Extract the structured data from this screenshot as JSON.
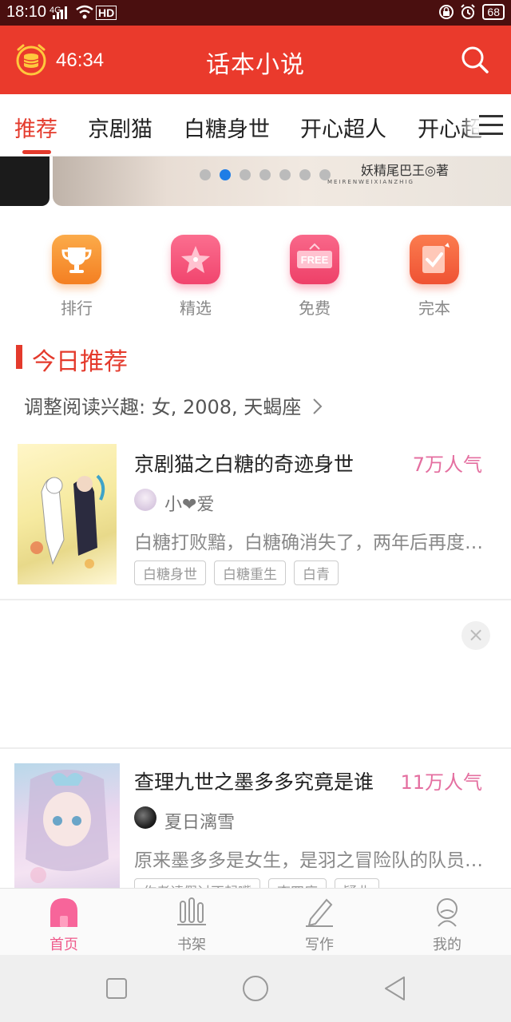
{
  "status_bar": {
    "time": "18:10",
    "signal": "4G",
    "network": "HD",
    "battery": "68"
  },
  "header": {
    "timer": "46:34",
    "title": "话本小说"
  },
  "tabs": [
    {
      "label": "推荐",
      "active": true
    },
    {
      "label": "京剧猫",
      "active": false
    },
    {
      "label": "白糖身世",
      "active": false
    },
    {
      "label": "开心超人",
      "active": false
    },
    {
      "label": "开心超",
      "active": false
    }
  ],
  "banner": {
    "author": "妖精尾巴王◎著",
    "subtitle": "MEIRENWEIXIANZHIG",
    "page_count": 7,
    "active_page": 2
  },
  "quick_entries": [
    {
      "label": "排行",
      "icon": "trophy-icon",
      "color": "#f79033"
    },
    {
      "label": "精选",
      "icon": "star-icon",
      "color": "#f5577c"
    },
    {
      "label": "免费",
      "icon": "free-icon",
      "color": "#f25479"
    },
    {
      "label": "完本",
      "icon": "check-badge-icon",
      "color": "#f2643c"
    }
  ],
  "section": {
    "title": "今日推荐",
    "interest": "调整阅读兴趣: 女, 2008, 天蝎座"
  },
  "books": [
    {
      "title": "京剧猫之白糖的奇迹身世",
      "popularity": "7万人气",
      "author": "小❤爱",
      "description": "白糖打败黯，白糖确消失了，两年后再度…",
      "tags": [
        "白糖身世",
        "白糖重生",
        "白青"
      ]
    },
    {
      "title": "查理九世之墨多多究竟是谁",
      "popularity": "11万人气",
      "author": "夏日漓雪",
      "description": "原来墨多多是女生，是羽之冒险队的队员…",
      "tags": [
        "作者请假讨不起嘴",
        "查四度",
        "疑曲"
      ]
    }
  ],
  "ad": {
    "close_symbol": "×"
  },
  "bottom_nav": [
    {
      "label": "首页",
      "icon": "home-icon",
      "active": true
    },
    {
      "label": "书架",
      "icon": "bookshelf-icon",
      "active": false
    },
    {
      "label": "写作",
      "icon": "pen-icon",
      "active": false
    },
    {
      "label": "我的",
      "icon": "profile-icon",
      "active": false
    }
  ],
  "colors": {
    "primary": "#ea3a2c",
    "accent_pink": "#ef5b8c",
    "popularity": "#e46fa0",
    "dot_active": "#1f7de6"
  }
}
